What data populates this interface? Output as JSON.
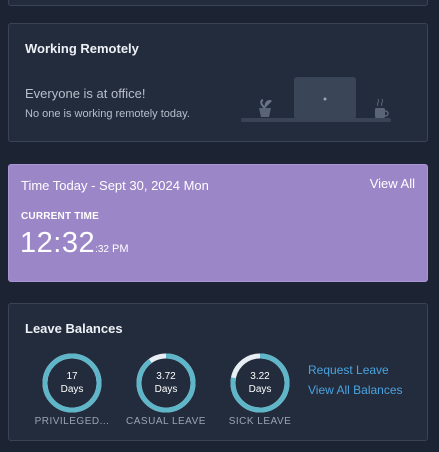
{
  "remote": {
    "title": "Working Remotely",
    "main": "Everyone is at office!",
    "sub": "No one is working remotely today."
  },
  "time": {
    "title": "Time Today - Sept 30, 2024 Mon",
    "view_all": "View All",
    "current_label": "CURRENT TIME",
    "hm": "12:32",
    "sec": ":32",
    "ampm": "PM"
  },
  "leave": {
    "title": "Leave Balances",
    "items": [
      {
        "value": "17",
        "unit": "Days",
        "label": "PRIVILEGED...",
        "fraction": 1.0
      },
      {
        "value": "3.72",
        "unit": "Days",
        "label": "CASUAL LEAVE",
        "fraction": 0.9
      },
      {
        "value": "3.22",
        "unit": "Days",
        "label": "SICK LEAVE",
        "fraction": 0.78
      }
    ],
    "request_link": "Request Leave",
    "view_balances_link": "View All Balances"
  },
  "colors": {
    "ring": "#5fb6c9",
    "ring_track": "#e8eef3",
    "time_card": "#9b86c7",
    "link": "#4aa3e0"
  }
}
